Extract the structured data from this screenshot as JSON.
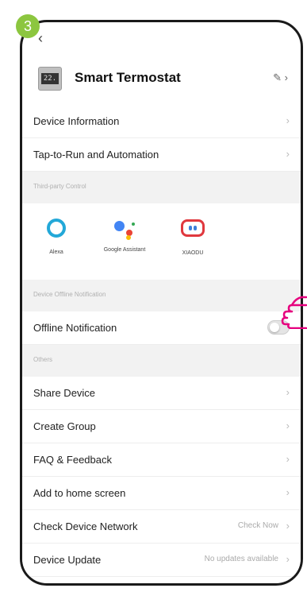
{
  "step_badge": "3",
  "header": {
    "device_icon_text": "22.",
    "title": "Smart Termostat"
  },
  "rows_top": [
    {
      "label": "Device Information"
    },
    {
      "label": "Tap-to-Run and Automation"
    }
  ],
  "third_party": {
    "section_title": "Third-party Control",
    "items": [
      {
        "label": "Alexa",
        "icon": "alexa-icon"
      },
      {
        "label": "Google Assistant",
        "icon": "google-assistant-icon"
      },
      {
        "label": "XIAODU",
        "icon": "xiaodu-icon"
      }
    ]
  },
  "offline": {
    "section_title": "Device Offline Notification",
    "label": "Offline Notification",
    "enabled": false
  },
  "others": {
    "section_title": "Others",
    "items": [
      {
        "label": "Share Device",
        "value": ""
      },
      {
        "label": "Create Group",
        "value": ""
      },
      {
        "label": "FAQ & Feedback",
        "value": ""
      },
      {
        "label": "Add to home screen",
        "value": ""
      },
      {
        "label": "Check Device Network",
        "value": "Check Now"
      },
      {
        "label": "Device Update",
        "value": "No updates available"
      }
    ]
  },
  "colors": {
    "badge": "#8cc63f",
    "hand": "#e6007e"
  }
}
